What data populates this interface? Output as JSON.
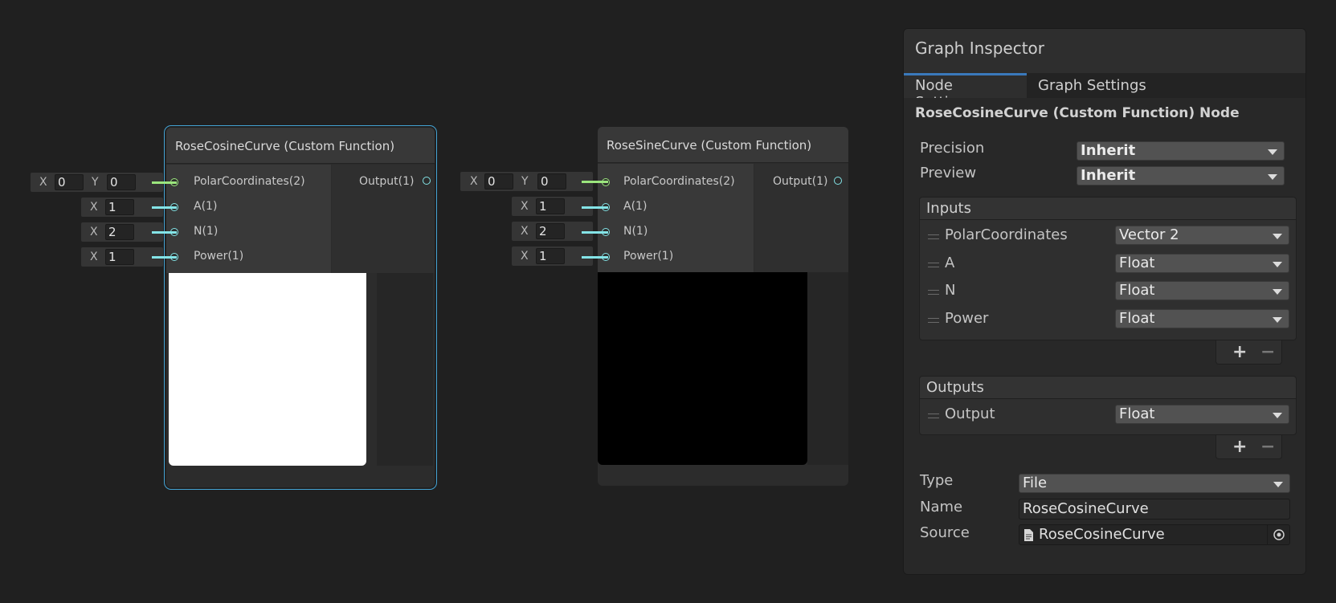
{
  "nodes": [
    {
      "title": "RoseCosineCurve (Custom Function)",
      "inputs": [
        "PolarCoordinates(2)",
        "A(1)",
        "N(1)",
        "Power(1)"
      ],
      "output": "Output(1)",
      "preview_color": "#ffffff",
      "fields": {
        "polar": {
          "x_label": "X",
          "x_value": "0",
          "y_label": "Y",
          "y_value": "0"
        },
        "a": {
          "label": "X",
          "value": "1"
        },
        "n": {
          "label": "X",
          "value": "2"
        },
        "power": {
          "label": "X",
          "value": "1"
        }
      }
    },
    {
      "title": "RoseSineCurve (Custom Function)",
      "inputs": [
        "PolarCoordinates(2)",
        "A(1)",
        "N(1)",
        "Power(1)"
      ],
      "output": "Output(1)",
      "preview_color": "#000000",
      "fields": {
        "polar": {
          "x_label": "X",
          "x_value": "0",
          "y_label": "Y",
          "y_value": "0"
        },
        "a": {
          "label": "X",
          "value": "1"
        },
        "n": {
          "label": "X",
          "value": "2"
        },
        "power": {
          "label": "X",
          "value": "1"
        }
      }
    }
  ],
  "inspector": {
    "title": "Graph Inspector",
    "tabs": [
      "Node Settings",
      "Graph Settings"
    ],
    "active_tab": "Node Settings",
    "node_heading": "RoseCosineCurve (Custom Function) Node",
    "precision": {
      "label": "Precision",
      "value": "Inherit"
    },
    "preview": {
      "label": "Preview",
      "value": "Inherit"
    },
    "inputs": {
      "header": "Inputs",
      "items": [
        {
          "name": "PolarCoordinates",
          "type": "Vector 2"
        },
        {
          "name": "A",
          "type": "Float"
        },
        {
          "name": "N",
          "type": "Float"
        },
        {
          "name": "Power",
          "type": "Float"
        }
      ]
    },
    "outputs": {
      "header": "Outputs",
      "items": [
        {
          "name": "Output",
          "type": "Float"
        }
      ]
    },
    "plus": "+",
    "minus": "−",
    "type": {
      "label": "Type",
      "value": "File"
    },
    "name": {
      "label": "Name",
      "value": "RoseCosineCurve"
    },
    "source": {
      "label": "Source",
      "value": "RoseCosineCurve"
    }
  }
}
